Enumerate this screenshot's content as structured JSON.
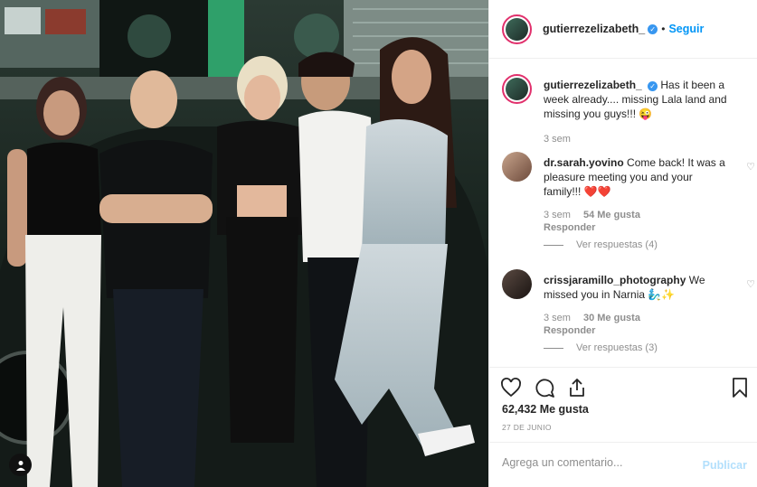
{
  "post": {
    "username": "gutierrezelizabeth_",
    "verified_icon": "verified-badge-icon",
    "separator": "•",
    "follow_label": "Seguir"
  },
  "caption": {
    "username": "gutierrezelizabeth_",
    "text": "Has it been a week already.... missing Lala land and missing you guys!!! 😜",
    "time": "3 sem"
  },
  "comments": [
    {
      "username": "dr.sarah.yovino",
      "text": "Come back! It was a pleasure meeting you and your family!!! ❤️❤️",
      "time": "3 sem",
      "likes": "54 Me gusta",
      "reply_label": "Responder",
      "view_replies": "Ver respuestas (4)"
    },
    {
      "username": "crissjaramillo_photography",
      "text": "We missed you in Narnia 🧞‍♂️✨",
      "time": "3 sem",
      "likes": "30 Me gusta",
      "reply_label": "Responder",
      "view_replies": "Ver respuestas (3)"
    }
  ],
  "actions": {
    "like_icon": "heart-icon",
    "comment_icon": "comment-icon",
    "share_icon": "share-icon",
    "save_icon": "bookmark-icon"
  },
  "likes_text": "62,432 Me gusta",
  "date_text": "27 DE JUNIO",
  "add_comment": {
    "placeholder": "Agrega un comentario...",
    "post_label": "Publicar"
  },
  "colors": {
    "accent": "#0095f6",
    "verified": "#3897f0",
    "muted": "#8e8e8e",
    "story_ring": "#e1306c"
  }
}
